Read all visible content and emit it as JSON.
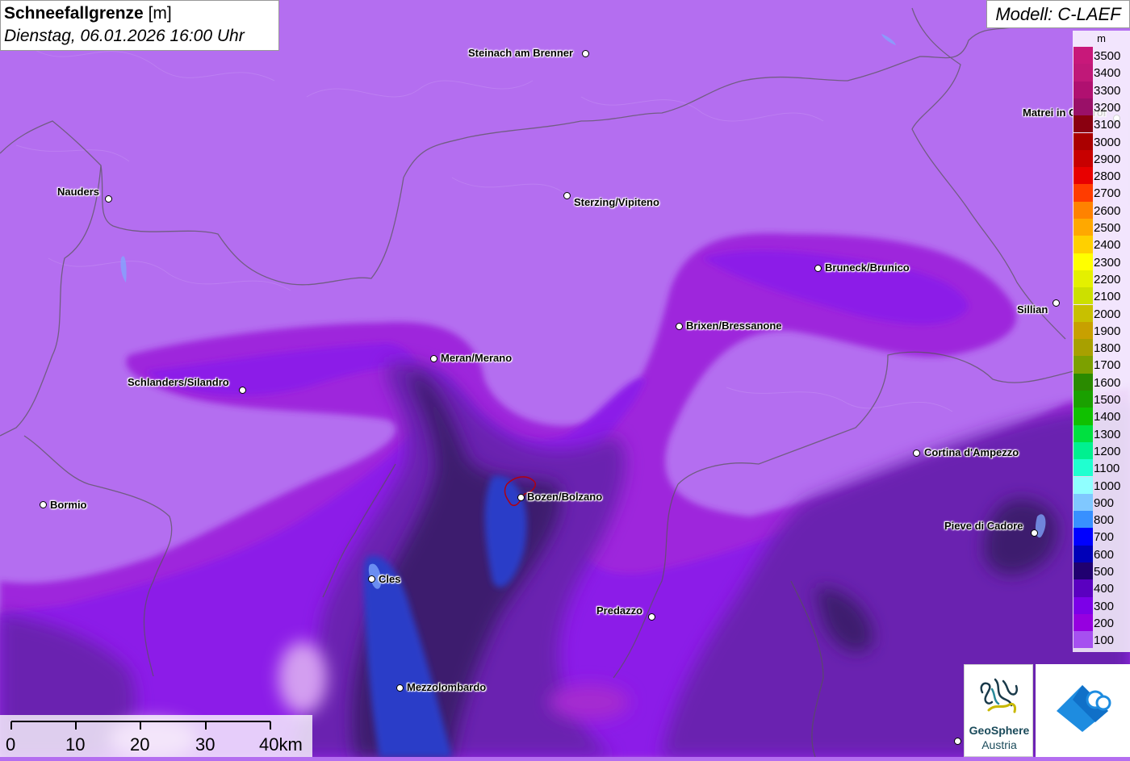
{
  "title": {
    "main": "Schneefallgrenze",
    "unit": "[m]",
    "datetime": "Dienstag, 06.01.2026 16:00 Uhr"
  },
  "model": "Modell: C-LAEF",
  "legend": {
    "unit": "m",
    "levels": [
      {
        "label": "3500",
        "color": "#c8187a"
      },
      {
        "label": "3400",
        "color": "#c01878"
      },
      {
        "label": "3300",
        "color": "#b01070"
      },
      {
        "label": "3200",
        "color": "#9a1068"
      },
      {
        "label": "3100",
        "color": "#8a0010"
      },
      {
        "label": "3000",
        "color": "#aa0000"
      },
      {
        "label": "2900",
        "color": "#c80000"
      },
      {
        "label": "2800",
        "color": "#e80000"
      },
      {
        "label": "2700",
        "color": "#ff3c00"
      },
      {
        "label": "2600",
        "color": "#ff8200"
      },
      {
        "label": "2500",
        "color": "#ffa800"
      },
      {
        "label": "2400",
        "color": "#ffd000"
      },
      {
        "label": "2300",
        "color": "#ffff00"
      },
      {
        "label": "2200",
        "color": "#e4f000"
      },
      {
        "label": "2100",
        "color": "#cce000"
      },
      {
        "label": "2000",
        "color": "#c8c000"
      },
      {
        "label": "1900",
        "color": "#c8a000"
      },
      {
        "label": "1800",
        "color": "#a8a000"
      },
      {
        "label": "1700",
        "color": "#7ca000"
      },
      {
        "label": "1600",
        "color": "#2a8a00"
      },
      {
        "label": "1500",
        "color": "#1aa000"
      },
      {
        "label": "1400",
        "color": "#10c000"
      },
      {
        "label": "1300",
        "color": "#00e040"
      },
      {
        "label": "1200",
        "color": "#00f090"
      },
      {
        "label": "1100",
        "color": "#20ffd0"
      },
      {
        "label": "1000",
        "color": "#90ffff"
      },
      {
        "label": "900",
        "color": "#80c8ff"
      },
      {
        "label": "800",
        "color": "#3890ff"
      },
      {
        "label": "700",
        "color": "#0000ff"
      },
      {
        "label": "600",
        "color": "#0000b8"
      },
      {
        "label": "500",
        "color": "#200070"
      },
      {
        "label": "400",
        "color": "#5a00c0"
      },
      {
        "label": "300",
        "color": "#7c00e8"
      },
      {
        "label": "200",
        "color": "#9600e0"
      },
      {
        "label": "100",
        "color": "#a650f0"
      }
    ]
  },
  "scale": {
    "labels": [
      "0",
      "10",
      "20",
      "30",
      "40km"
    ]
  },
  "cities": [
    {
      "name": "Steinach am Brenner"
    },
    {
      "name": "Matrei in Osttirol"
    },
    {
      "name": "Nauders"
    },
    {
      "name": "Sterzing/Vipiteno"
    },
    {
      "name": "Bruneck/Brunico"
    },
    {
      "name": "Sillian"
    },
    {
      "name": "Brixen/Bressanone"
    },
    {
      "name": "Meran/Merano"
    },
    {
      "name": "Schlanders/Silandro"
    },
    {
      "name": "Cortina d'Ampezzo"
    },
    {
      "name": "Bormio"
    },
    {
      "name": "Bozen/Bolzano"
    },
    {
      "name": "Pieve di Cadore"
    },
    {
      "name": "Cles"
    },
    {
      "name": "Predazzo"
    },
    {
      "name": "Mezzolombardo"
    }
  ],
  "logo": {
    "line1": "GeoSphere",
    "line2": "Austria"
  }
}
